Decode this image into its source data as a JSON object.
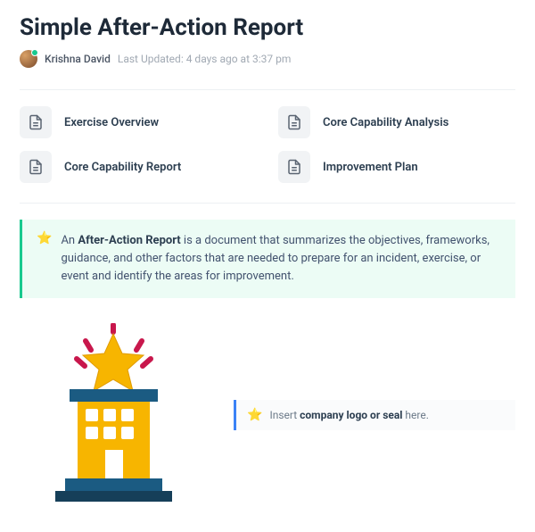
{
  "title": "Simple After-Action Report",
  "author": "Krishna David",
  "last_updated": "Last Updated: 4 days ago at 3:37 pm",
  "toc": [
    {
      "label": "Exercise Overview"
    },
    {
      "label": "Core Capability Analysis"
    },
    {
      "label": "Core Capability Report"
    },
    {
      "label": "Improvement Plan"
    }
  ],
  "callout": {
    "prefix": "An ",
    "bold": "After-Action Report",
    "rest": " is a document that summarizes the objectives, frameworks, guidance, and other factors that are needed to prepare for an incident, exercise, or event and identify the areas for improvement."
  },
  "logo_hint": {
    "prefix": "Insert ",
    "bold": "company logo or seal",
    "rest": " here."
  }
}
